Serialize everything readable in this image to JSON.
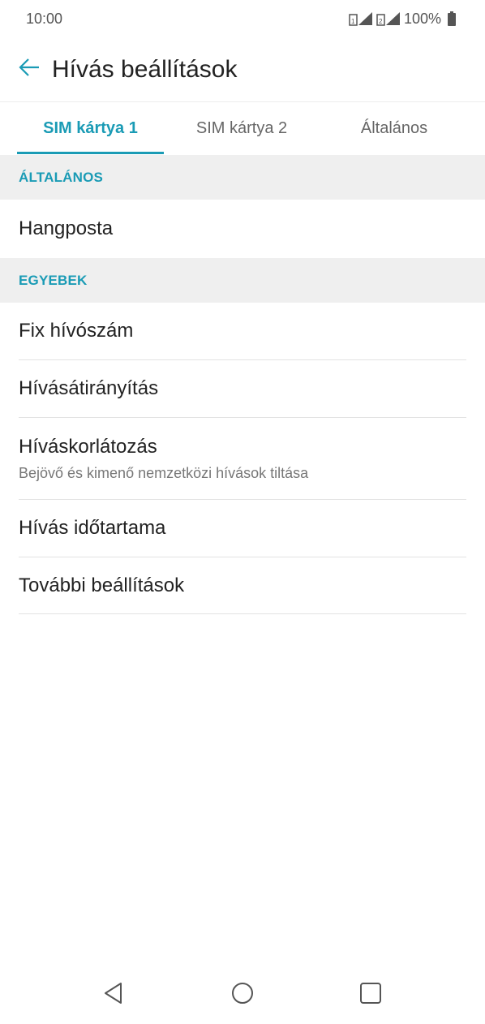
{
  "status_bar": {
    "time": "10:00",
    "battery_text": "100%",
    "icons": [
      "sim1-signal-icon",
      "sim2-signal-icon",
      "battery-icon"
    ]
  },
  "app_bar": {
    "title": "Hívás beállítások",
    "back_icon": "back-arrow-icon"
  },
  "tabs": [
    {
      "label": "SIM kártya 1",
      "active": true
    },
    {
      "label": "SIM kártya 2",
      "active": false
    },
    {
      "label": "Általános",
      "active": false
    }
  ],
  "sections": {
    "general": {
      "header": "ÁLTALÁNOS",
      "items": [
        {
          "label": "Hangposta"
        }
      ]
    },
    "other": {
      "header": "EGYEBEK",
      "items": [
        {
          "label": "Fix hívószám"
        },
        {
          "label": "Hívásátirányítás"
        },
        {
          "label": "Híváskorlátozás",
          "subtitle": "Bejövő és kimenő nemzetközi hívások tiltása"
        },
        {
          "label": "Hívás időtartama"
        },
        {
          "label": "További beállítások"
        }
      ]
    }
  },
  "nav_bar": {
    "icons": [
      "back-triangle-icon",
      "home-circle-icon",
      "recents-square-icon"
    ]
  },
  "colors": {
    "accent": "#1a9bb5",
    "section_bg": "#efefef",
    "text_primary": "#222222",
    "text_secondary": "#777777"
  }
}
